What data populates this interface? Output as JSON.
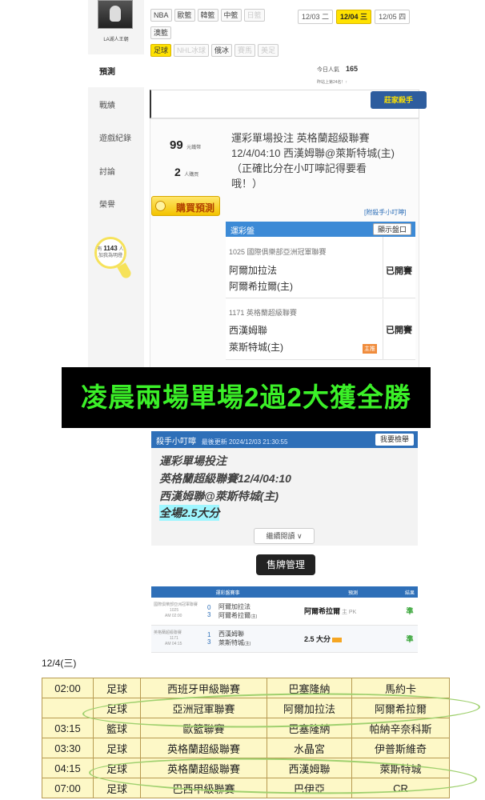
{
  "profile": {
    "username": "LA湖人王朝"
  },
  "top_filters": {
    "row1": [
      {
        "label": "NBA",
        "state": "normal"
      },
      {
        "label": "歐籃",
        "state": "normal"
      },
      {
        "label": "韓籃",
        "state": "normal"
      },
      {
        "label": "中籃",
        "state": "normal"
      },
      {
        "label": "日籃",
        "state": "dim"
      }
    ],
    "row2": [
      {
        "label": "澳籃",
        "state": "normal"
      }
    ],
    "row3": [
      {
        "label": "足球",
        "state": "active"
      },
      {
        "label": "NHL冰球",
        "state": "dim"
      },
      {
        "label": "俄冰",
        "state": "normal"
      },
      {
        "label": "賽馬",
        "state": "dim"
      },
      {
        "label": "美足",
        "state": "dim"
      }
    ],
    "dates": [
      {
        "label": "12/03 二",
        "active": false
      },
      {
        "label": "12/04 三",
        "active": true
      },
      {
        "label": "12/05 四",
        "active": false
      }
    ]
  },
  "stats": {
    "today_label": "今日人氣",
    "today_value": "165",
    "rank_label": "昨站上第24名！↑"
  },
  "sidebar": {
    "items": [
      {
        "label": "預測",
        "active": true
      },
      {
        "label": "戰績",
        "active": false
      },
      {
        "label": "遊戲紀錄",
        "active": false
      },
      {
        "label": "討論",
        "active": false
      },
      {
        "label": "榮譽",
        "active": false
      }
    ],
    "followers_prefix": "有",
    "followers_count": "1143",
    "followers_suffix": "人",
    "followers_note": "加我為明燈"
  },
  "seal_label": "莊家殺手",
  "prediction": {
    "price": "99",
    "price_unit": "元鐵幣",
    "buyers": "2",
    "buyers_unit": "人購買",
    "buy_button": "購買預測",
    "title_lines": [
      "運彩單場投注 英格蘭超級聯賽",
      "12/4/04:10 西漢姆聯@萊斯特城(主)",
      "（正確比分在小叮嚀記得要看",
      "哦！）"
    ],
    "note_link": "[附殺手小叮嚀]",
    "table_header": "運彩盤",
    "table_toggle": "顯示盤口",
    "matches": [
      {
        "meta": "1025 國際俱樂部亞洲冠軍聯賽",
        "team_a": "阿爾加拉法",
        "team_b": "阿爾希拉爾(主)",
        "status": "已開賽",
        "tag": ""
      },
      {
        "meta": "1171 英格蘭超級聯賽",
        "team_a": "西漢姆聯",
        "team_b": "萊斯特城(主)",
        "status": "已開賽",
        "tag": "主推"
      }
    ]
  },
  "banner": "凌晨兩場單場2過2大獲全勝",
  "tips": {
    "header_title": "殺手小叮嚀",
    "header_time": "最後更新 2024/12/03 21:30:55",
    "report_button": "我要檢舉",
    "lines": [
      {
        "text": "運彩單場投注",
        "highlight": false
      },
      {
        "text": "英格蘭超級聯賽12/4/04:10",
        "highlight": false
      },
      {
        "text": "西漢姆聯@萊斯特城(主)",
        "highlight": false
      },
      {
        "text": "全場2.5大分",
        "highlight": true
      }
    ],
    "more_button": "繼續閱讀 ∨",
    "sell_button": "售牌管理"
  },
  "history": {
    "headers": [
      "運彩盤賽事",
      "預測",
      "結果"
    ],
    "rows": [
      {
        "meta_league": "國際俱樂部亞洲冠軍聯賽",
        "meta_id": "1025",
        "meta_time": "AM 02:00",
        "num_a": "0",
        "team_a": "阿爾加拉法",
        "num_b": "3",
        "team_b": "阿爾希拉爾",
        "team_b_tag": "(主)",
        "pred": "阿爾希拉爾",
        "pred_extra": "主 PK",
        "result": "準"
      },
      {
        "meta_league": "英格蘭超級聯賽",
        "meta_id": "1171",
        "meta_time": "AM 04:15",
        "num_a": "1",
        "team_a": "西漢姆聯",
        "num_b": "3",
        "team_b": "萊斯特城",
        "team_b_tag": "(主)",
        "pred": "2.5 大分",
        "pred_extra": "",
        "result": "準"
      }
    ]
  },
  "schedule": {
    "date_label": "12/4(三)",
    "rows": [
      {
        "time": "02:00",
        "sport": "足球",
        "league": "西班牙甲級聯賽",
        "home": "巴塞隆納",
        "away": "馬約卡"
      },
      {
        "time": "",
        "sport": "足球",
        "league": "亞洲冠軍聯賽",
        "home": "阿爾加拉法",
        "away": "阿爾希拉爾"
      },
      {
        "time": "03:15",
        "sport": "籃球",
        "league": "歐籃聯賽",
        "home": "巴塞隆納",
        "away": "帕納辛奈科斯"
      },
      {
        "time": "03:30",
        "sport": "足球",
        "league": "英格蘭超級聯賽",
        "home": "水晶宮",
        "away": "伊普斯維奇"
      },
      {
        "time": "04:15",
        "sport": "足球",
        "league": "英格蘭超級聯賽",
        "home": "西漢姆聯",
        "away": "萊斯特城"
      },
      {
        "time": "07:00",
        "sport": "足球",
        "league": "巴西甲級聯賽",
        "home": "巴伊亞",
        "away": "CR"
      }
    ]
  },
  "colors": {
    "accent_blue": "#2e6fb8",
    "highlight_yellow": "#ffe200",
    "banner_green": "#3bf028",
    "oval_green": "#9fd06e"
  }
}
